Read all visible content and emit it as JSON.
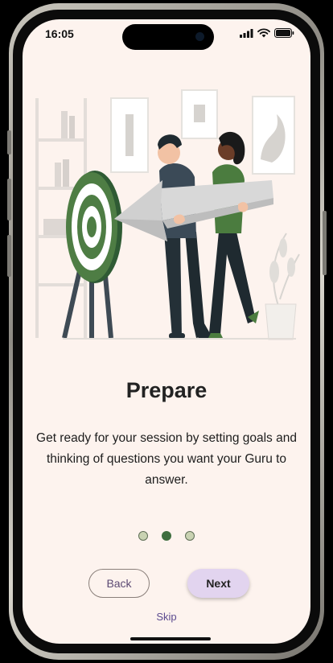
{
  "status_bar": {
    "time": "16:05",
    "icons": [
      "signal-icon",
      "wifi-icon",
      "battery-icon"
    ]
  },
  "onboarding": {
    "title": "Prepare",
    "description": "Get ready for your session by setting goals and thinking of questions you want your Guru to answer.",
    "current_page": 2,
    "total_pages": 3
  },
  "buttons": {
    "back_label": "Back",
    "next_label": "Next",
    "skip_label": "Skip"
  },
  "colors": {
    "background": "#fdf3ee",
    "accent_green": "#3f6e3f",
    "next_button": "#e2d4ef",
    "link_purple": "#5c4a8f"
  }
}
